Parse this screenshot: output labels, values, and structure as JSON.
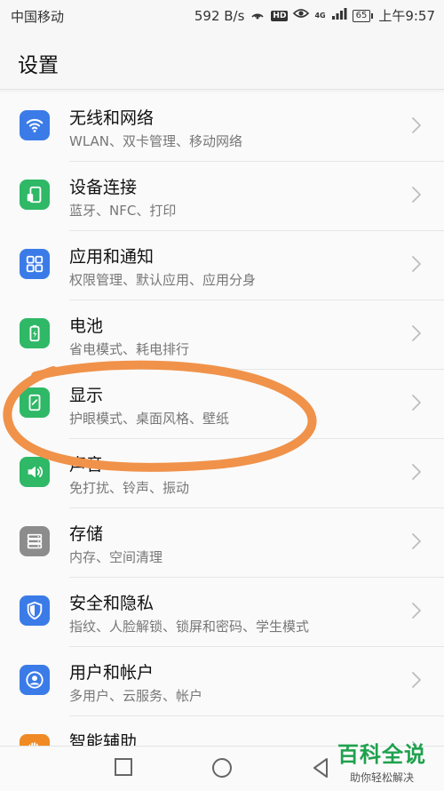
{
  "status_bar": {
    "carrier": "中国移动",
    "speed": "592 B/s",
    "hd": "HD",
    "signal": "4G",
    "battery": "65",
    "time": "上午9:57"
  },
  "header": {
    "title": "设置"
  },
  "settings": [
    {
      "title": "无线和网络",
      "subtitle": "WLAN、双卡管理、移动网络",
      "icon": "wifi-icon",
      "color": "#3b7be8"
    },
    {
      "title": "设备连接",
      "subtitle": "蓝牙、NFC、打印",
      "icon": "device-connect-icon",
      "color": "#2fb866"
    },
    {
      "title": "应用和通知",
      "subtitle": "权限管理、默认应用、应用分身",
      "icon": "apps-grid-icon",
      "color": "#3b7be8"
    },
    {
      "title": "电池",
      "subtitle": "省电模式、耗电排行",
      "icon": "battery-icon",
      "color": "#2fb866"
    },
    {
      "title": "显示",
      "subtitle": "护眼模式、桌面风格、壁纸",
      "icon": "display-icon",
      "color": "#2fb866"
    },
    {
      "title": "声音",
      "subtitle": "免打扰、铃声、振动",
      "icon": "speaker-icon",
      "color": "#2fb866"
    },
    {
      "title": "存储",
      "subtitle": "内存、空间清理",
      "icon": "storage-icon",
      "color": "#8c8c8c"
    },
    {
      "title": "安全和隐私",
      "subtitle": "指纹、人脸解锁、锁屏和密码、学生模式",
      "icon": "shield-icon",
      "color": "#3b7be8"
    },
    {
      "title": "用户和帐户",
      "subtitle": "多用户、云服务、帐户",
      "icon": "user-icon",
      "color": "#3b7be8"
    },
    {
      "title": "智能辅助",
      "subtitle": "",
      "icon": "hand-icon",
      "color": "#f08a24"
    }
  ],
  "watermark": {
    "title": "百科全说",
    "subtitle": "助你轻松解决"
  },
  "annotation_color": "#f0924a"
}
